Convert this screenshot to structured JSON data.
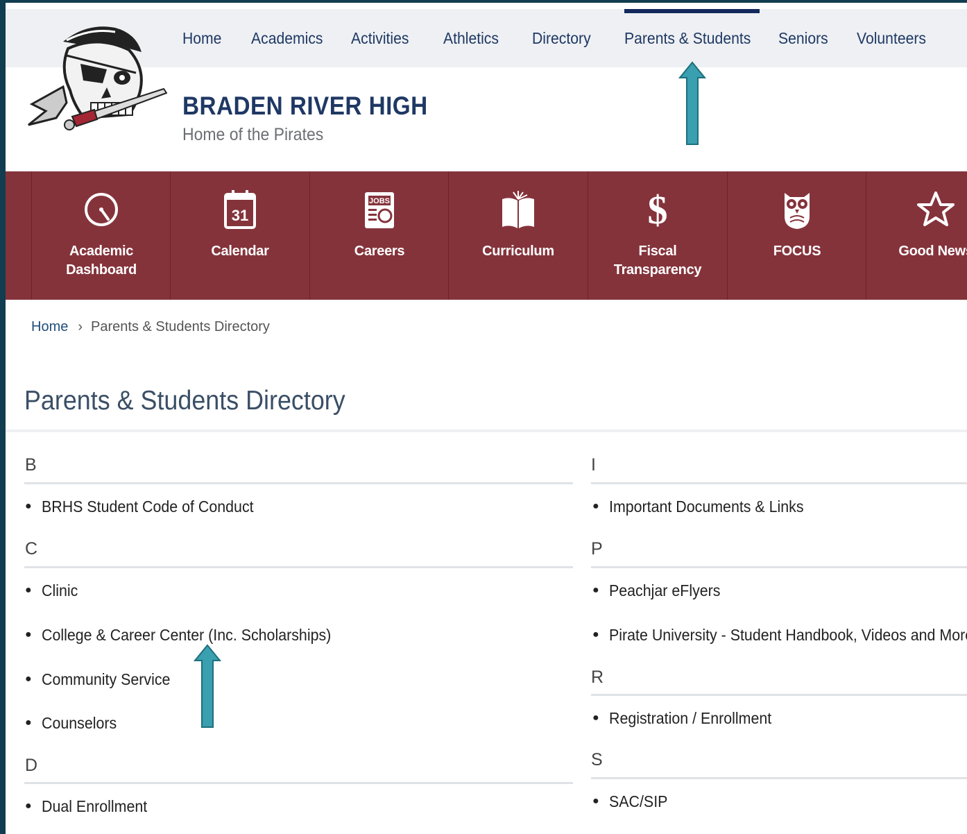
{
  "top_nav": {
    "items": [
      {
        "label": "Home"
      },
      {
        "label": "Academics"
      },
      {
        "label": "Activities"
      },
      {
        "label": "Athletics"
      },
      {
        "label": "Directory"
      },
      {
        "label": "Parents & Students",
        "active": true
      },
      {
        "label": "Seniors"
      },
      {
        "label": "Volunteers"
      }
    ]
  },
  "header": {
    "school_name": "BRADEN RIVER HIGH",
    "tagline": "Home of the Pirates",
    "logo_icon": "pirate-skull-logo"
  },
  "quick_links": [
    {
      "label": "Academic\nDashboard",
      "icon": "gauge-icon"
    },
    {
      "label": "Calendar",
      "icon": "calendar-icon",
      "icon_text": "31"
    },
    {
      "label": "Careers",
      "icon": "jobs-newspaper-icon",
      "icon_text": "JOBS"
    },
    {
      "label": "Curriculum",
      "icon": "open-book-icon"
    },
    {
      "label": "Fiscal\nTransparency",
      "icon": "dollar-icon",
      "icon_text": "$"
    },
    {
      "label": "FOCUS",
      "icon": "owl-icon"
    },
    {
      "label": "Good News",
      "icon": "star-icon"
    }
  ],
  "breadcrumb": {
    "home": "Home",
    "separator": "›",
    "current": "Parents & Students Directory"
  },
  "page_title": "Parents & Students Directory",
  "directory": {
    "left": [
      {
        "letter": "B",
        "items": [
          "BRHS Student Code of Conduct"
        ]
      },
      {
        "letter": "C",
        "items": [
          "Clinic",
          "College & Career Center (Inc. Scholarships)",
          "Community Service",
          "Counselors"
        ]
      },
      {
        "letter": "D",
        "items": [
          "Dual Enrollment"
        ]
      }
    ],
    "right": [
      {
        "letter": "I",
        "items": [
          "Important Documents & Links"
        ]
      },
      {
        "letter": "P",
        "items": [
          "Peachjar eFlyers",
          "Pirate University - Student Handbook, Videos and More"
        ]
      },
      {
        "letter": "R",
        "items": [
          "Registration / Enrollment"
        ]
      },
      {
        "letter": "S",
        "items": [
          "SAC/SIP"
        ]
      }
    ]
  },
  "colors": {
    "nav_text": "#1f3864",
    "quick_bar": "#85333b",
    "annotation_arrow": "#3a9fae"
  }
}
